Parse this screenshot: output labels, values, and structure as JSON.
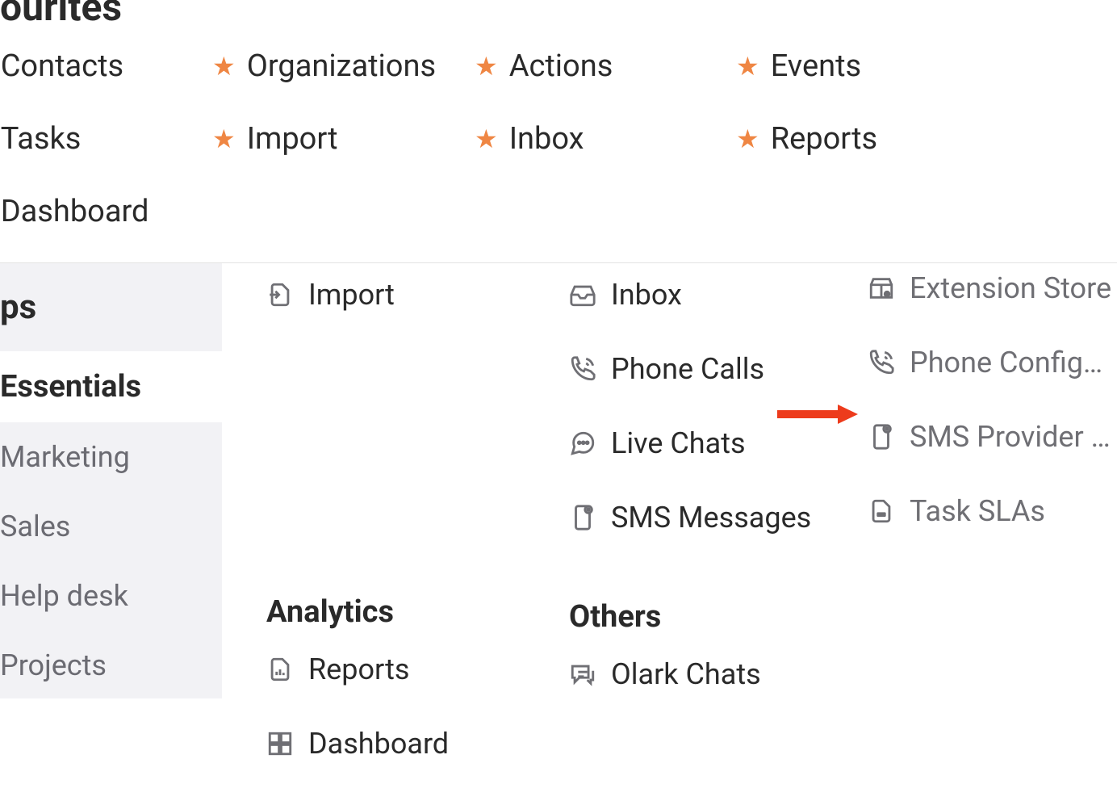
{
  "top_title_partial": "ourites",
  "favorites": {
    "r1c1": "Contacts",
    "r1c2": "Organizations",
    "r1c3": "Actions",
    "r1c4": "Events",
    "r2c1": "Tasks",
    "r2c2": "Import",
    "r2c3": "Inbox",
    "r2c4": "Reports",
    "r3c1": "Dashboard"
  },
  "sidebar": {
    "heading_partial": "ps",
    "active": "Essentials",
    "items": [
      "Marketing",
      "Sales",
      "Help desk",
      "Projects"
    ]
  },
  "col1": {
    "import": "Import",
    "analytics_head": "Analytics",
    "reports": "Reports",
    "dashboard_partial": "Dashboard"
  },
  "col2": {
    "inbox": "Inbox",
    "phone_calls": "Phone Calls",
    "live_chats": "Live Chats",
    "sms_messages": "SMS Messages",
    "others_head": "Others",
    "olark": "Olark Chats"
  },
  "col3": {
    "ext_store": "Extension Store",
    "phone_config": "Phone Configuration",
    "sms_provider": "SMS Provider Configuration",
    "task_slas": "Task SLAs"
  }
}
